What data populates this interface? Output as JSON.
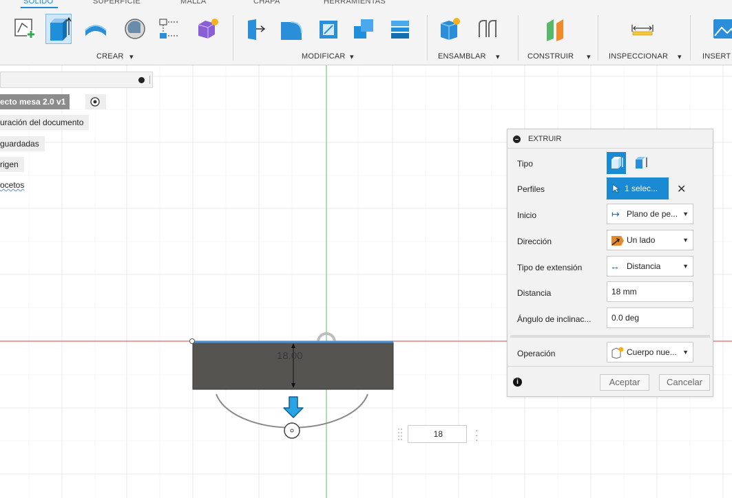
{
  "ribbon": {
    "tabs": [
      "SÓLIDO",
      "SUPERFICIE",
      "MALLA",
      "CHAPA",
      "HERRAMIENTAS"
    ],
    "groups": {
      "crear": "CREAR",
      "modificar": "MODIFICAR",
      "ensamblar": "ENSAMBLAR",
      "construir": "CONSTRUIR",
      "inspeccionar": "INSPECCIONAR",
      "insertar": "INSERT"
    },
    "dropdown_glyph": "▾"
  },
  "browser": {
    "items": [
      "ecto mesa 2.0 v1",
      "uración del documento",
      "guardadas",
      "rigen",
      "ocetos"
    ]
  },
  "canvas": {
    "dimension_label": "18.00",
    "value_input": "18"
  },
  "extrude_panel": {
    "title": "EXTRUIR",
    "rows": {
      "tipo": "Tipo",
      "perfiles": "Perfiles",
      "inicio": "Inicio",
      "direccion": "Dirección",
      "tipo_extension": "Tipo de extensión",
      "distancia": "Distancia",
      "angulo": "Ángulo de inclinac...",
      "operacion": "Operación"
    },
    "values": {
      "perfiles": "1 selec...",
      "inicio": "Plano de pe...",
      "direccion": "Un lado",
      "tipo_extension": "Distancia",
      "distancia": "18 mm",
      "angulo": "0.0 deg",
      "operacion": "Cuerpo nue..."
    },
    "buttons": {
      "ok": "Aceptar",
      "cancel": "Cancelar"
    }
  },
  "colors": {
    "accent": "#1a8ad4",
    "body_fill": "#555450",
    "axis_red": "#e06666",
    "axis_green": "#7cc97c"
  }
}
